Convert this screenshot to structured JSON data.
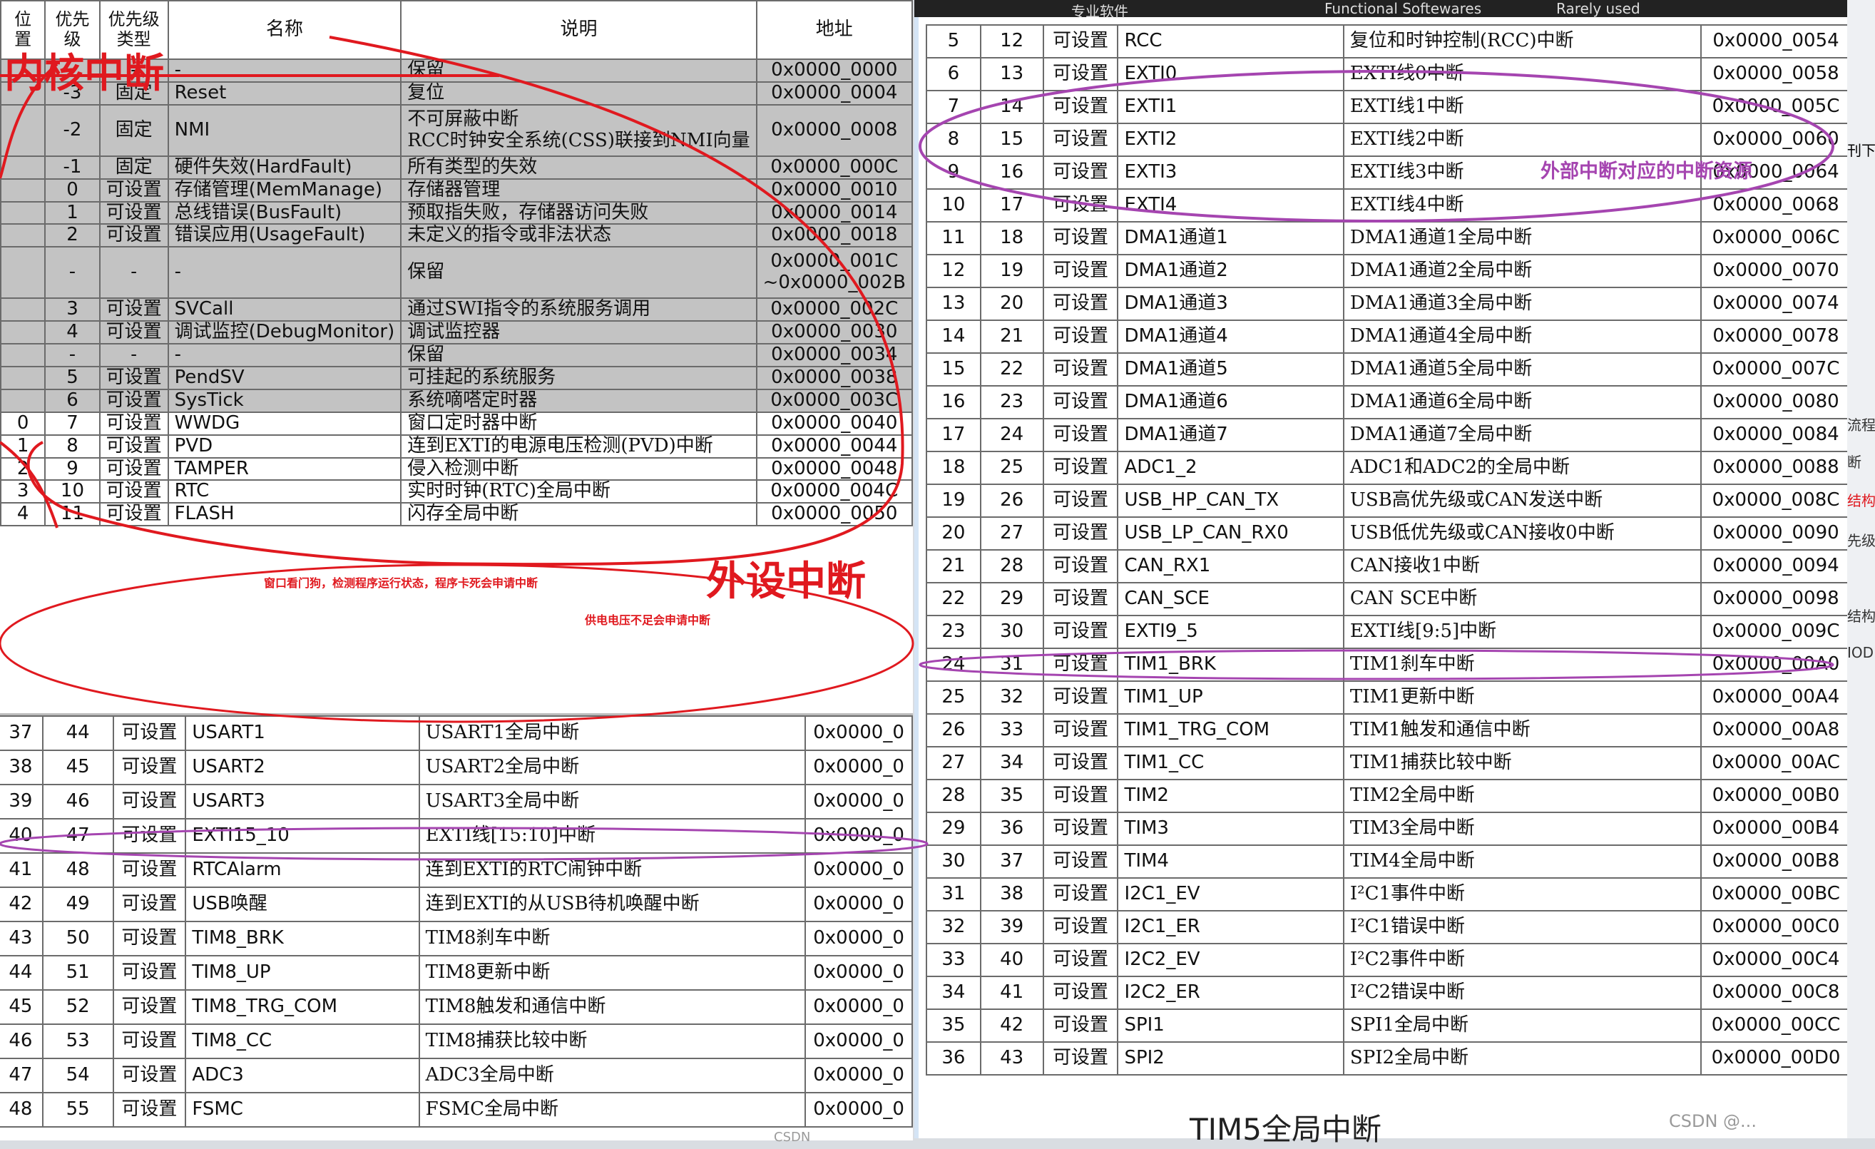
{
  "panel_a": {
    "headers": [
      "位置",
      "优先级",
      "优先级类型",
      "名称",
      "说明",
      "地址"
    ],
    "rows": [
      {
        "pos": "",
        "pri": "-",
        "type": "-",
        "name": "-",
        "desc": "保留",
        "addr": "0x0000_0000",
        "grey": true
      },
      {
        "pos": "",
        "pri": "-3",
        "type": "固定",
        "name": "Reset",
        "desc": "复位",
        "addr": "0x0000_0004",
        "grey": true
      },
      {
        "pos": "",
        "pri": "-2",
        "type": "固定",
        "name": "NMI",
        "desc": "不可屏蔽中断",
        "desc2": "RCC时钟安全系统(CSS)联接到NMI向量",
        "addr": "0x0000_0008",
        "grey": true
      },
      {
        "pos": "",
        "pri": "-1",
        "type": "固定",
        "name": "硬件失效(HardFault)",
        "desc": "所有类型的失效",
        "addr": "0x0000_000C",
        "grey": true
      },
      {
        "pos": "",
        "pri": "0",
        "type": "可设置",
        "name": "存储管理(MemManage)",
        "desc": "存储器管理",
        "addr": "0x0000_0010",
        "grey": true
      },
      {
        "pos": "",
        "pri": "1",
        "type": "可设置",
        "name": "总线错误(BusFault)",
        "desc": "预取指失败，存储器访问失败",
        "addr": "0x0000_0014",
        "grey": true
      },
      {
        "pos": "",
        "pri": "2",
        "type": "可设置",
        "name": "错误应用(UsageFault)",
        "desc": "未定义的指令或非法状态",
        "addr": "0x0000_0018",
        "grey": true
      },
      {
        "pos": "",
        "pri": "-",
        "type": "-",
        "name": "-",
        "desc": "保留",
        "addr": "0x0000_001C",
        "addr2": "~0x0000_002B",
        "grey": true
      },
      {
        "pos": "",
        "pri": "3",
        "type": "可设置",
        "name": "SVCall",
        "desc": "通过SWI指令的系统服务调用",
        "addr": "0x0000_002C",
        "grey": true
      },
      {
        "pos": "",
        "pri": "4",
        "type": "可设置",
        "name": "调试监控(DebugMonitor)",
        "desc": "调试监控器",
        "addr": "0x0000_0030",
        "grey": true
      },
      {
        "pos": "",
        "pri": "-",
        "type": "-",
        "name": "-",
        "desc": "保留",
        "addr": "0x0000_0034",
        "grey": true
      },
      {
        "pos": "",
        "pri": "5",
        "type": "可设置",
        "name": "PendSV",
        "desc": "可挂起的系统服务",
        "addr": "0x0000_0038",
        "grey": true
      },
      {
        "pos": "",
        "pri": "6",
        "type": "可设置",
        "name": "SysTick",
        "desc": "系统嘀嗒定时器",
        "addr": "0x0000_003C",
        "grey": true
      },
      {
        "pos": "0",
        "pri": "7",
        "type": "可设置",
        "name": "WWDG",
        "desc": "窗口定时器中断",
        "addr": "0x0000_0040",
        "grey": false
      },
      {
        "pos": "1",
        "pri": "8",
        "type": "可设置",
        "name": "PVD",
        "desc": "连到EXTI的电源电压检测(PVD)中断",
        "addr": "0x0000_0044",
        "grey": false
      },
      {
        "pos": "2",
        "pri": "9",
        "type": "可设置",
        "name": "TAMPER",
        "desc": "侵入检测中断",
        "addr": "0x0000_0048",
        "grey": false
      },
      {
        "pos": "3",
        "pri": "10",
        "type": "可设置",
        "name": "RTC",
        "desc": "实时时钟(RTC)全局中断",
        "addr": "0x0000_004C",
        "grey": false
      },
      {
        "pos": "4",
        "pri": "11",
        "type": "可设置",
        "name": "FLASH",
        "desc": "闪存全局中断",
        "addr": "0x0000_0050",
        "grey": false
      }
    ]
  },
  "panel_b": {
    "rows": [
      {
        "pos": "37",
        "pri": "44",
        "type": "可设置",
        "name": "USART1",
        "desc": "USART1全局中断",
        "addr": "0x0000_0"
      },
      {
        "pos": "38",
        "pri": "45",
        "type": "可设置",
        "name": "USART2",
        "desc": "USART2全局中断",
        "addr": "0x0000_0"
      },
      {
        "pos": "39",
        "pri": "46",
        "type": "可设置",
        "name": "USART3",
        "desc": "USART3全局中断",
        "addr": "0x0000_0"
      },
      {
        "pos": "40",
        "pri": "47",
        "type": "可设置",
        "name": "EXTI15_10",
        "desc": "EXTI线[15:10]中断",
        "addr": "0x0000_0"
      },
      {
        "pos": "41",
        "pri": "48",
        "type": "可设置",
        "name": "RTCAlarm",
        "desc": "连到EXTI的RTC闹钟中断",
        "addr": "0x0000_0"
      },
      {
        "pos": "42",
        "pri": "49",
        "type": "可设置",
        "name": "USB唤醒",
        "desc": "连到EXTI的从USB待机唤醒中断",
        "addr": "0x0000_0"
      },
      {
        "pos": "43",
        "pri": "50",
        "type": "可设置",
        "name": "TIM8_BRK",
        "desc": "TIM8刹车中断",
        "addr": "0x0000_0"
      },
      {
        "pos": "44",
        "pri": "51",
        "type": "可设置",
        "name": "TIM8_UP",
        "desc": "TIM8更新中断",
        "addr": "0x0000_0"
      },
      {
        "pos": "45",
        "pri": "52",
        "type": "可设置",
        "name": "TIM8_TRG_COM",
        "desc": "TIM8触发和通信中断",
        "addr": "0x0000_0"
      },
      {
        "pos": "46",
        "pri": "53",
        "type": "可设置",
        "name": "TIM8_CC",
        "desc": "TIM8捕获比较中断",
        "addr": "0x0000_0"
      },
      {
        "pos": "47",
        "pri": "54",
        "type": "可设置",
        "name": "ADC3",
        "desc": "ADC3全局中断",
        "addr": "0x0000_0"
      },
      {
        "pos": "48",
        "pri": "55",
        "type": "可设置",
        "name": "FSMC",
        "desc": "FSMC全局中断",
        "addr": "0x0000_0"
      }
    ]
  },
  "panel_c": {
    "rows": [
      {
        "pos": "5",
        "pri": "12",
        "type": "可设置",
        "name": "RCC",
        "desc": "复位和时钟控制(RCC)中断",
        "addr": "0x0000_0054"
      },
      {
        "pos": "6",
        "pri": "13",
        "type": "可设置",
        "name": "EXTI0",
        "desc": "EXTI线0中断",
        "addr": "0x0000_0058"
      },
      {
        "pos": "7",
        "pri": "14",
        "type": "可设置",
        "name": "EXTI1",
        "desc": "EXTI线1中断",
        "addr": "0x0000_005C"
      },
      {
        "pos": "8",
        "pri": "15",
        "type": "可设置",
        "name": "EXTI2",
        "desc": "EXTI线2中断",
        "addr": "0x0000_0060"
      },
      {
        "pos": "9",
        "pri": "16",
        "type": "可设置",
        "name": "EXTI3",
        "desc": "EXTI线3中断",
        "addr": "0x0000_0064"
      },
      {
        "pos": "10",
        "pri": "17",
        "type": "可设置",
        "name": "EXTI4",
        "desc": "EXTI线4中断",
        "addr": "0x0000_0068"
      },
      {
        "pos": "11",
        "pri": "18",
        "type": "可设置",
        "name": "DMA1通道1",
        "desc": "DMA1通道1全局中断",
        "addr": "0x0000_006C"
      },
      {
        "pos": "12",
        "pri": "19",
        "type": "可设置",
        "name": "DMA1通道2",
        "desc": "DMA1通道2全局中断",
        "addr": "0x0000_0070"
      },
      {
        "pos": "13",
        "pri": "20",
        "type": "可设置",
        "name": "DMA1通道3",
        "desc": "DMA1通道3全局中断",
        "addr": "0x0000_0074"
      },
      {
        "pos": "14",
        "pri": "21",
        "type": "可设置",
        "name": "DMA1通道4",
        "desc": "DMA1通道4全局中断",
        "addr": "0x0000_0078"
      },
      {
        "pos": "15",
        "pri": "22",
        "type": "可设置",
        "name": "DMA1通道5",
        "desc": "DMA1通道5全局中断",
        "addr": "0x0000_007C"
      },
      {
        "pos": "16",
        "pri": "23",
        "type": "可设置",
        "name": "DMA1通道6",
        "desc": "DMA1通道6全局中断",
        "addr": "0x0000_0080"
      },
      {
        "pos": "17",
        "pri": "24",
        "type": "可设置",
        "name": "DMA1通道7",
        "desc": "DMA1通道7全局中断",
        "addr": "0x0000_0084"
      },
      {
        "pos": "18",
        "pri": "25",
        "type": "可设置",
        "name": "ADC1_2",
        "desc": "ADC1和ADC2的全局中断",
        "addr": "0x0000_0088"
      },
      {
        "pos": "19",
        "pri": "26",
        "type": "可设置",
        "name": "USB_HP_CAN_TX",
        "desc": "USB高优先级或CAN发送中断",
        "addr": "0x0000_008C"
      },
      {
        "pos": "20",
        "pri": "27",
        "type": "可设置",
        "name": "USB_LP_CAN_RX0",
        "desc": "USB低优先级或CAN接收0中断",
        "addr": "0x0000_0090"
      },
      {
        "pos": "21",
        "pri": "28",
        "type": "可设置",
        "name": "CAN_RX1",
        "desc": "CAN接收1中断",
        "addr": "0x0000_0094"
      },
      {
        "pos": "22",
        "pri": "29",
        "type": "可设置",
        "name": "CAN_SCE",
        "desc": "CAN SCE中断",
        "addr": "0x0000_0098"
      },
      {
        "pos": "23",
        "pri": "30",
        "type": "可设置",
        "name": "EXTI9_5",
        "desc": "EXTI线[9:5]中断",
        "addr": "0x0000_009C"
      },
      {
        "pos": "24",
        "pri": "31",
        "type": "可设置",
        "name": "TIM1_BRK",
        "desc": "TIM1刹车中断",
        "addr": "0x0000_00A0"
      },
      {
        "pos": "25",
        "pri": "32",
        "type": "可设置",
        "name": "TIM1_UP",
        "desc": "TIM1更新中断",
        "addr": "0x0000_00A4"
      },
      {
        "pos": "26",
        "pri": "33",
        "type": "可设置",
        "name": "TIM1_TRG_COM",
        "desc": "TIM1触发和通信中断",
        "addr": "0x0000_00A8"
      },
      {
        "pos": "27",
        "pri": "34",
        "type": "可设置",
        "name": "TIM1_CC",
        "desc": "TIM1捕获比较中断",
        "addr": "0x0000_00AC"
      },
      {
        "pos": "28",
        "pri": "35",
        "type": "可设置",
        "name": "TIM2",
        "desc": "TIM2全局中断",
        "addr": "0x0000_00B0"
      },
      {
        "pos": "29",
        "pri": "36",
        "type": "可设置",
        "name": "TIM3",
        "desc": "TIM3全局中断",
        "addr": "0x0000_00B4"
      },
      {
        "pos": "30",
        "pri": "37",
        "type": "可设置",
        "name": "TIM4",
        "desc": "TIM4全局中断",
        "addr": "0x0000_00B8"
      },
      {
        "pos": "31",
        "pri": "38",
        "type": "可设置",
        "name": "I2C1_EV",
        "desc": "I²C1事件中断",
        "addr": "0x0000_00BC"
      },
      {
        "pos": "32",
        "pri": "39",
        "type": "可设置",
        "name": "I2C1_ER",
        "desc": "I²C1错误中断",
        "addr": "0x0000_00C0"
      },
      {
        "pos": "33",
        "pri": "40",
        "type": "可设置",
        "name": "I2C2_EV",
        "desc": "I²C2事件中断",
        "addr": "0x0000_00C4"
      },
      {
        "pos": "34",
        "pri": "41",
        "type": "可设置",
        "name": "I2C2_ER",
        "desc": "I²C2错误中断",
        "addr": "0x0000_00C8"
      },
      {
        "pos": "35",
        "pri": "42",
        "type": "可设置",
        "name": "SPI1",
        "desc": "SPI1全局中断",
        "addr": "0x0000_00CC"
      },
      {
        "pos": "36",
        "pri": "43",
        "type": "可设置",
        "name": "SPI2",
        "desc": "SPI2全局中断",
        "addr": "0x0000_00D0"
      }
    ]
  },
  "annotations": {
    "core_interrupt": "内核中断",
    "peripheral_interrupt": "外设中断",
    "wwdg_note": "窗口看门狗，检测程序运行状态，程序卡死会申请中断",
    "pvd_note": "供电电压不足会申请中断",
    "exti_note": "外部中断对应的中断资源"
  },
  "top_strip": [
    "专业软件",
    "Functional Softewares",
    "Rarely used"
  ],
  "watermarks": [
    "CSDN",
    "CSDN @..."
  ],
  "edge_fragments": [
    "刊下载",
    "流程",
    "断",
    "结构",
    "先级",
    "结构",
    "IOD"
  ],
  "bottom_fragment": "TIM5全局中断",
  "colors": {
    "grey_row": "#c3c3c3",
    "red_annotation": "#e0191f",
    "purple_annotation": "#a545b0"
  }
}
